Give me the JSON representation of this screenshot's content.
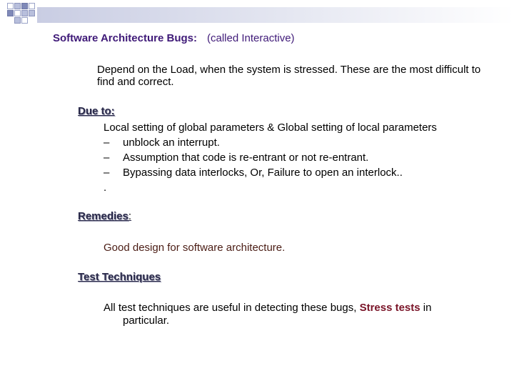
{
  "title": {
    "main": "Software Architecture Bugs:",
    "sub": "(called Interactive)"
  },
  "description": "Depend on the Load, when the system is stressed.  These are the most difficult to find and correct.",
  "due_to": {
    "heading": "Due to:",
    "lead": "Local setting of global parameters & Global setting of local parameters",
    "items": [
      {
        "dash": "–",
        "text": "unblock an interrupt."
      },
      {
        "dash": "–",
        "text": "Assumption that code is re-entrant or not re-entrant."
      },
      {
        "dash": "–",
        "text": "Bypassing data interlocks,  Or, Failure to open an interlock.."
      }
    ],
    "trailing": "."
  },
  "remedies": {
    "heading": "Remedies",
    "colon": ":",
    "text": "Good design for software architecture."
  },
  "test_techniques": {
    "heading": "Test Techniques",
    "text_before": "All test techniques are useful in detecting these bugs,  ",
    "highlight": "Stress tests",
    "text_after": " in",
    "line2": "particular."
  },
  "colors": {
    "title": "#3f1a78",
    "highlight": "#7a1428",
    "remedy": "#4a1c14"
  }
}
